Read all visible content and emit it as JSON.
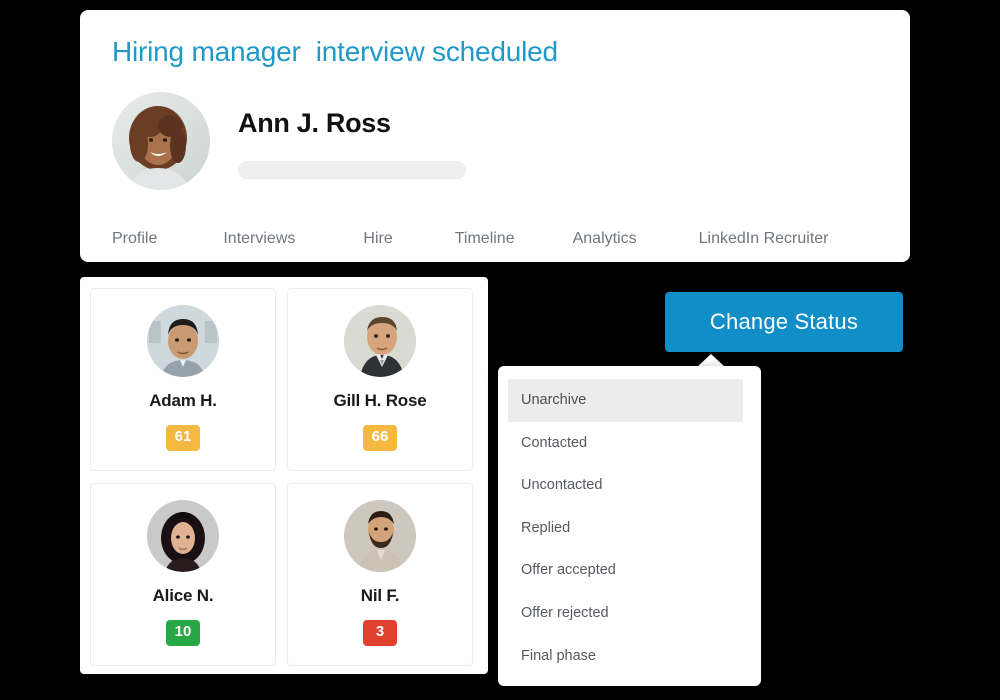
{
  "profile": {
    "title": "Hiring manager  interview scheduled",
    "title_color": "#2098c8",
    "name": "Ann J. Ross",
    "avatar_icon": "woman-avatar-photo",
    "placeholder_bar": "",
    "tabs": [
      {
        "label": "Profile"
      },
      {
        "label": "Interviews"
      },
      {
        "label": "Hire"
      },
      {
        "label": "Timeline"
      },
      {
        "label": "Analytics"
      },
      {
        "label": "LinkedIn Recruiter"
      }
    ]
  },
  "candidates": [
    {
      "name": "Adam H.",
      "badge": "61",
      "badge_color": "#f5b942",
      "avatar_icon": "man-avatar-photo-asian"
    },
    {
      "name": "Gill H. Rose",
      "badge": "66",
      "badge_color": "#f5b942",
      "avatar_icon": "man-avatar-photo-suit"
    },
    {
      "name": "Alice N.",
      "badge": "10",
      "badge_color": "#27a844",
      "avatar_icon": "woman-avatar-photo-dark-hair"
    },
    {
      "name": "Nil F.",
      "badge": "3",
      "badge_color": "#e0412f",
      "avatar_icon": "man-avatar-photo-beard"
    }
  ],
  "change_status": {
    "label": "Change Status",
    "color": "#0f8ec7",
    "caret_icon": "caret-up-icon"
  },
  "status_dropdown": {
    "items": [
      {
        "label": "Unarchive",
        "highlighted": true
      },
      {
        "label": "Contacted",
        "highlighted": false
      },
      {
        "label": "Uncontacted",
        "highlighted": false
      },
      {
        "label": "Replied",
        "highlighted": false
      },
      {
        "label": "Offer accepted",
        "highlighted": false
      },
      {
        "label": "Offer rejected",
        "highlighted": false
      },
      {
        "label": "Final phase",
        "highlighted": false
      }
    ]
  }
}
